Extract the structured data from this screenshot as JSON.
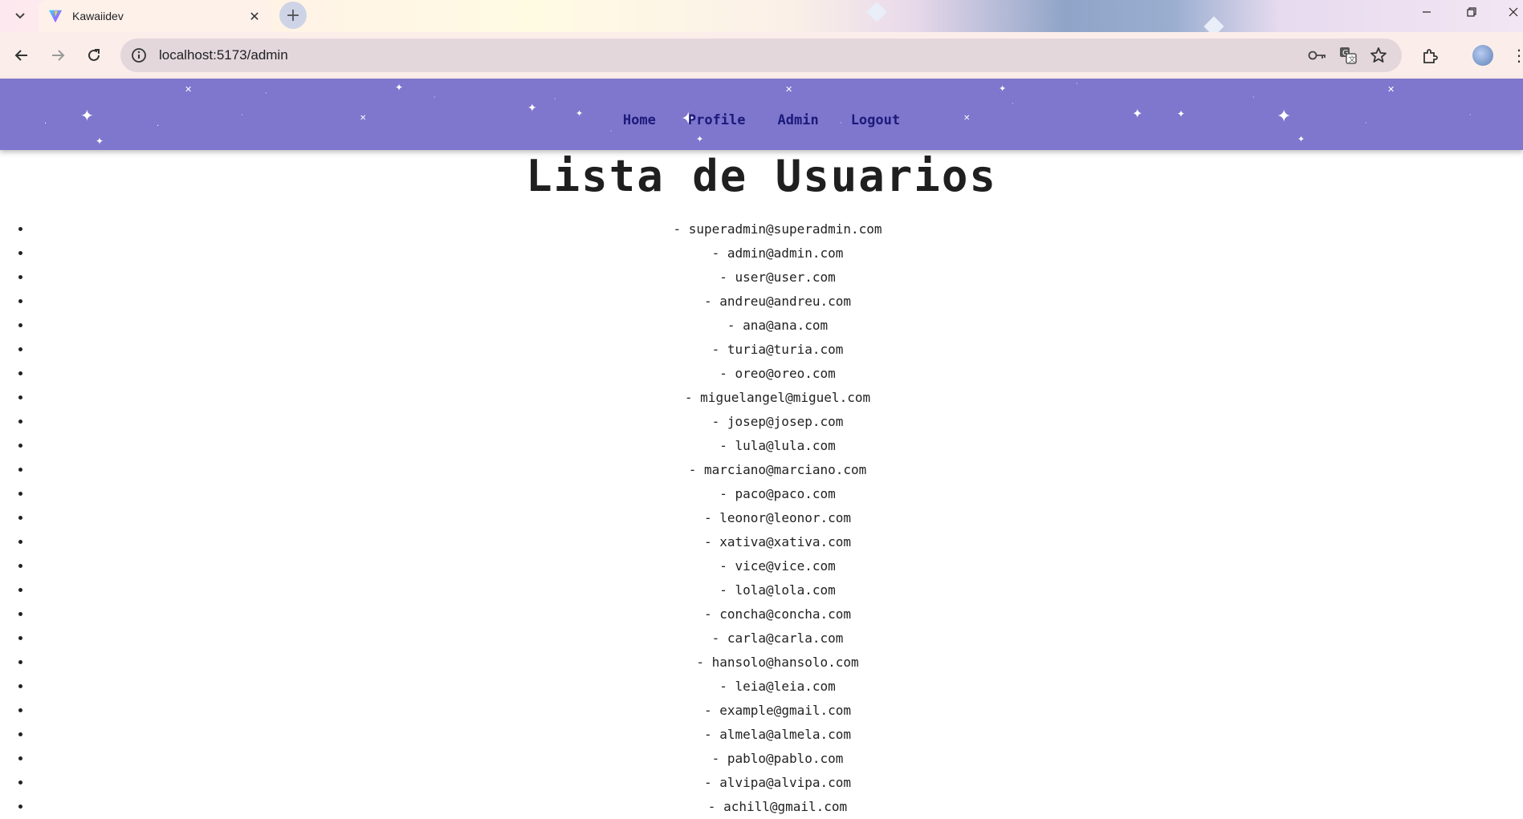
{
  "browser": {
    "tab_title": "Kawaiidev",
    "url": "localhost:5173/admin",
    "newtab_label": "+",
    "close_label": "✕"
  },
  "site_nav": {
    "links": [
      "Home",
      "Profile",
      "Admin",
      "Logout"
    ]
  },
  "page": {
    "title": "Lista de Usuarios"
  },
  "users": [
    "- superadmin@superadmin.com",
    "- admin@admin.com",
    "- user@user.com",
    "- andreu@andreu.com",
    "- ana@ana.com",
    "- turia@turia.com",
    "- oreo@oreo.com",
    "- miguelangel@miguel.com",
    "- josep@josep.com",
    "- lula@lula.com",
    "- marciano@marciano.com",
    "- paco@paco.com",
    "- leonor@leonor.com",
    "- xativa@xativa.com",
    "- vice@vice.com",
    "- lola@lola.com",
    "- concha@concha.com",
    "- carla@carla.com",
    "- hansolo@hansolo.com",
    "- leia@leia.com",
    "- example@gmail.com",
    "- almela@almela.com",
    "- pablo@pablo.com",
    "- alvipa@alvipa.com",
    "- achill@gmail.com"
  ],
  "icons": {
    "tab_list": "chevron-down-icon",
    "favicon": "vite-logo-icon",
    "back": "arrow-left-icon",
    "forward": "arrow-right-icon",
    "reload": "reload-icon",
    "site_info": "info-icon",
    "password": "key-icon",
    "translate": "translate-icon",
    "bookmark": "star-icon",
    "extensions": "puzzle-icon",
    "menu": "more-vert-icon"
  },
  "colors": {
    "nav_bg": "#7f76cd",
    "nav_link": "#1b1a7a",
    "text": "#222222"
  }
}
